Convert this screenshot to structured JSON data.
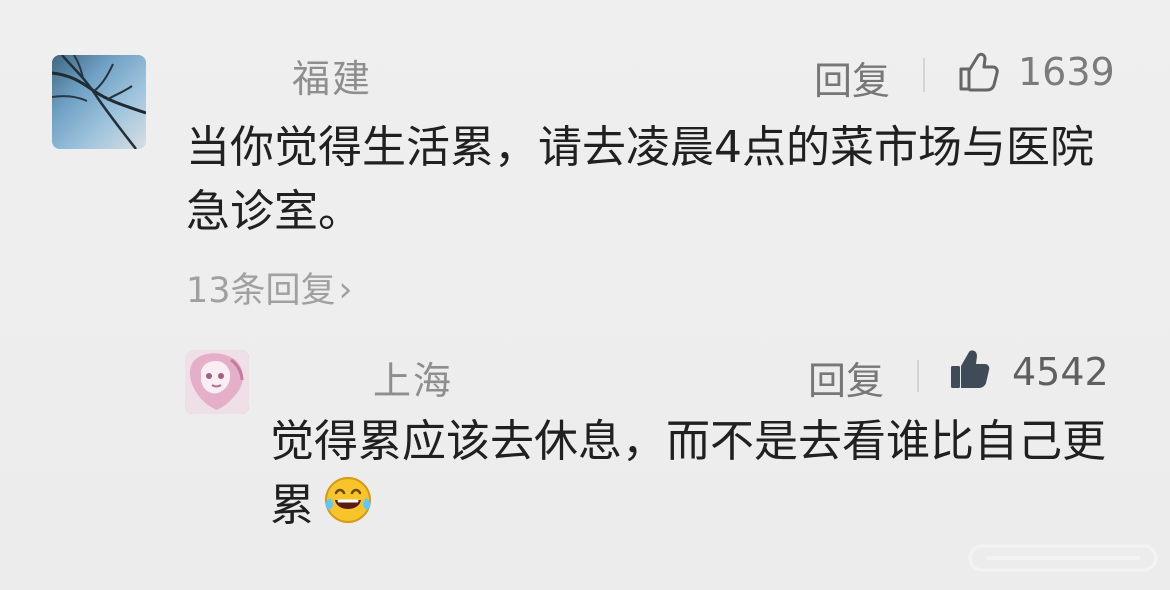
{
  "thread": {
    "top_comment": {
      "username": "福建",
      "reply_label": "回复",
      "likes": "1639",
      "text": "当你觉得生活累，请去凌晨4点的菜市场与医院急诊室。",
      "replies_link": "13条回复"
    },
    "nested_reply": {
      "username": "上海",
      "reply_label": "回复",
      "likes": "4542",
      "text": "觉得累应该去休息，而不是去看谁比自己更累"
    }
  },
  "icons": {
    "like_outline": "thumbs-up-outline-icon",
    "like_filled": "thumbs-up-filled-icon",
    "emoji": "laughing-tears-emoji-icon",
    "chevron": "chevron-right-icon"
  },
  "colors": {
    "background": "#ededed",
    "text_primary": "#202020",
    "text_secondary": "#8e8e8e",
    "like_active": "#3f4b57"
  }
}
